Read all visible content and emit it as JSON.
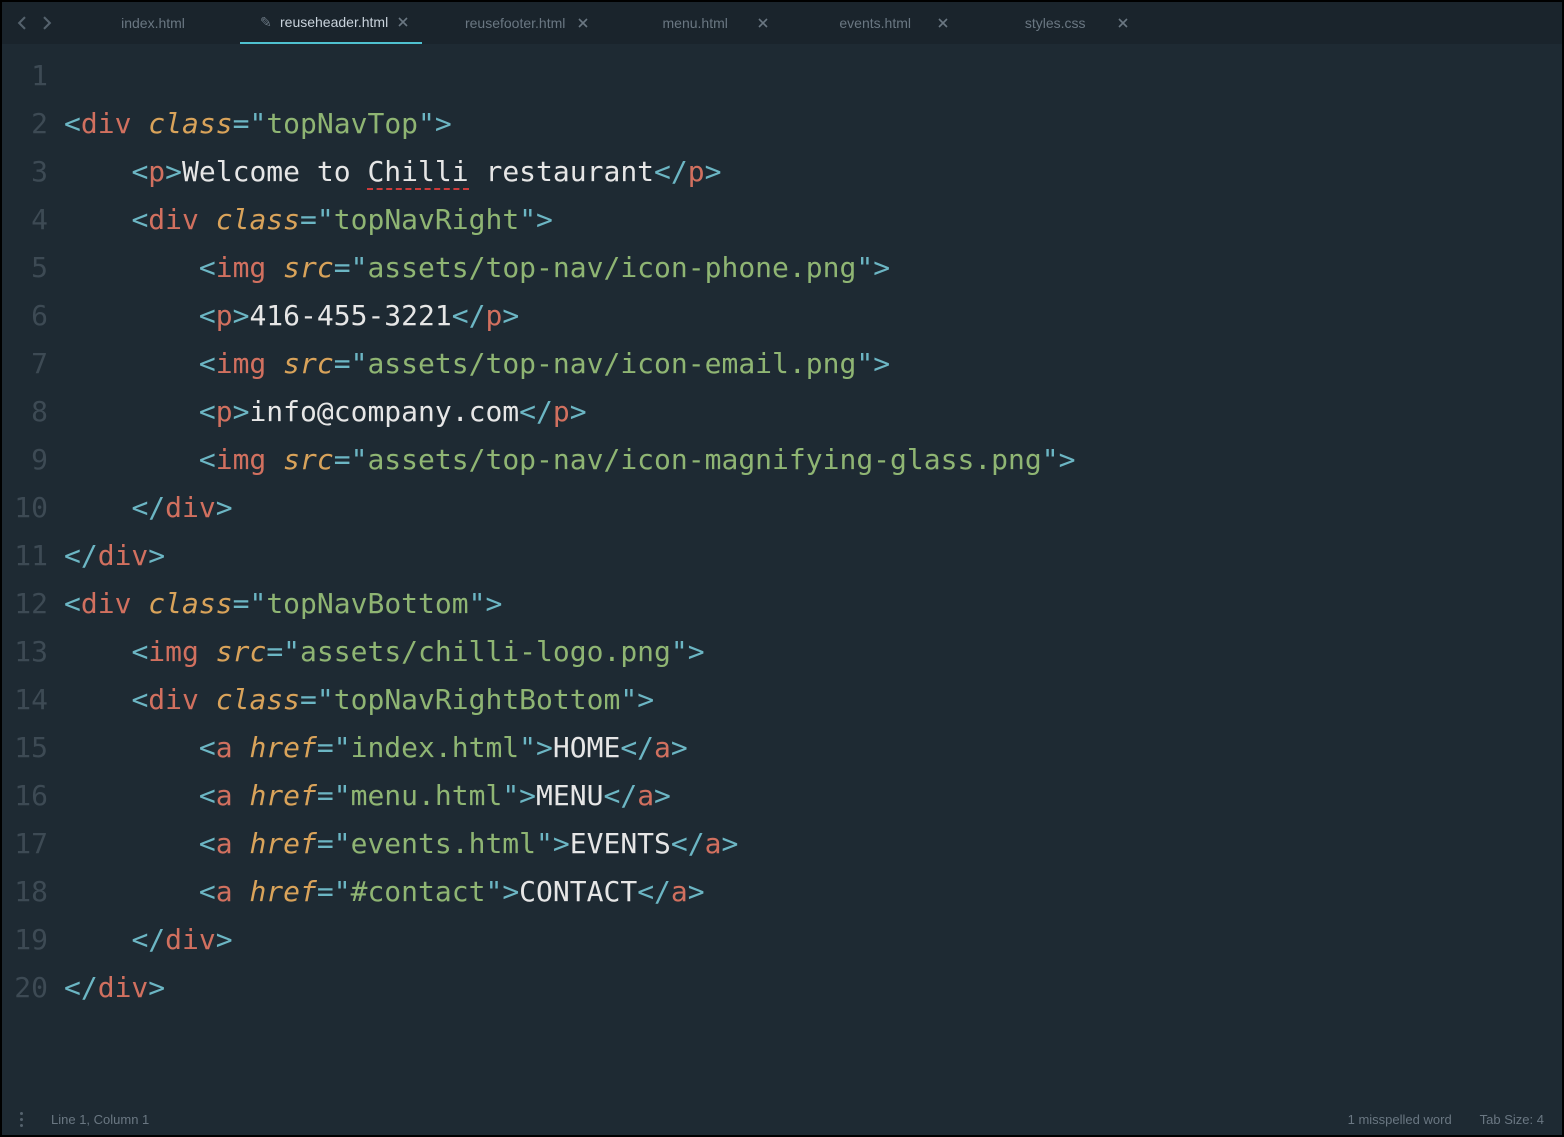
{
  "tabs": [
    {
      "label": "index.html",
      "active": false,
      "dirty": false,
      "closable": false
    },
    {
      "label": "reuseheader.html",
      "active": true,
      "dirty": true,
      "closable": true
    },
    {
      "label": "reusefooter.html",
      "active": false,
      "dirty": false,
      "closable": true
    },
    {
      "label": "menu.html",
      "active": false,
      "dirty": false,
      "closable": true
    },
    {
      "label": "events.html",
      "active": false,
      "dirty": false,
      "closable": true
    },
    {
      "label": "styles.css",
      "active": false,
      "dirty": false,
      "closable": true
    }
  ],
  "statusbar": {
    "position": "Line 1, Column 1",
    "spell": "1 misspelled word",
    "tabsize": "Tab Size: 4"
  },
  "code_lines": [
    [],
    [
      {
        "t": "punc",
        "v": "<"
      },
      {
        "t": "tag",
        "v": "div"
      },
      {
        "t": "text",
        "v": " "
      },
      {
        "t": "attr",
        "v": "class"
      },
      {
        "t": "punc",
        "v": "="
      },
      {
        "t": "punc",
        "v": "\""
      },
      {
        "t": "string",
        "v": "topNavTop"
      },
      {
        "t": "punc",
        "v": "\""
      },
      {
        "t": "punc",
        "v": ">"
      }
    ],
    [
      {
        "t": "text",
        "v": "    "
      },
      {
        "t": "punc",
        "v": "<"
      },
      {
        "t": "tag",
        "v": "p"
      },
      {
        "t": "punc",
        "v": ">"
      },
      {
        "t": "text",
        "v": "Welcome to "
      },
      {
        "t": "text",
        "v": "Chilli",
        "spell": true
      },
      {
        "t": "text",
        "v": " restaurant"
      },
      {
        "t": "punc",
        "v": "</"
      },
      {
        "t": "tag",
        "v": "p"
      },
      {
        "t": "punc",
        "v": ">"
      }
    ],
    [
      {
        "t": "text",
        "v": "    "
      },
      {
        "t": "punc",
        "v": "<"
      },
      {
        "t": "tag",
        "v": "div"
      },
      {
        "t": "text",
        "v": " "
      },
      {
        "t": "attr",
        "v": "class"
      },
      {
        "t": "punc",
        "v": "="
      },
      {
        "t": "punc",
        "v": "\""
      },
      {
        "t": "string",
        "v": "topNavRight"
      },
      {
        "t": "punc",
        "v": "\""
      },
      {
        "t": "punc",
        "v": ">"
      }
    ],
    [
      {
        "t": "text",
        "v": "        "
      },
      {
        "t": "punc",
        "v": "<"
      },
      {
        "t": "tag",
        "v": "img"
      },
      {
        "t": "text",
        "v": " "
      },
      {
        "t": "attr",
        "v": "src"
      },
      {
        "t": "punc",
        "v": "="
      },
      {
        "t": "punc",
        "v": "\""
      },
      {
        "t": "string",
        "v": "assets/top-nav/icon-phone.png"
      },
      {
        "t": "punc",
        "v": "\""
      },
      {
        "t": "punc",
        "v": ">"
      }
    ],
    [
      {
        "t": "text",
        "v": "        "
      },
      {
        "t": "punc",
        "v": "<"
      },
      {
        "t": "tag",
        "v": "p"
      },
      {
        "t": "punc",
        "v": ">"
      },
      {
        "t": "text",
        "v": "416-455-3221"
      },
      {
        "t": "punc",
        "v": "</"
      },
      {
        "t": "tag",
        "v": "p"
      },
      {
        "t": "punc",
        "v": ">"
      }
    ],
    [
      {
        "t": "text",
        "v": "        "
      },
      {
        "t": "punc",
        "v": "<"
      },
      {
        "t": "tag",
        "v": "img"
      },
      {
        "t": "text",
        "v": " "
      },
      {
        "t": "attr",
        "v": "src"
      },
      {
        "t": "punc",
        "v": "="
      },
      {
        "t": "punc",
        "v": "\""
      },
      {
        "t": "string",
        "v": "assets/top-nav/icon-email.png"
      },
      {
        "t": "punc",
        "v": "\""
      },
      {
        "t": "punc",
        "v": ">"
      }
    ],
    [
      {
        "t": "text",
        "v": "        "
      },
      {
        "t": "punc",
        "v": "<"
      },
      {
        "t": "tag",
        "v": "p"
      },
      {
        "t": "punc",
        "v": ">"
      },
      {
        "t": "text",
        "v": "info@company.com"
      },
      {
        "t": "punc",
        "v": "</"
      },
      {
        "t": "tag",
        "v": "p"
      },
      {
        "t": "punc",
        "v": ">"
      }
    ],
    [
      {
        "t": "text",
        "v": "        "
      },
      {
        "t": "punc",
        "v": "<"
      },
      {
        "t": "tag",
        "v": "img"
      },
      {
        "t": "text",
        "v": " "
      },
      {
        "t": "attr",
        "v": "src"
      },
      {
        "t": "punc",
        "v": "="
      },
      {
        "t": "punc",
        "v": "\""
      },
      {
        "t": "string",
        "v": "assets/top-nav/icon-magnifying-glass.png"
      },
      {
        "t": "punc",
        "v": "\""
      },
      {
        "t": "punc",
        "v": ">"
      }
    ],
    [
      {
        "t": "text",
        "v": "    "
      },
      {
        "t": "punc",
        "v": "</"
      },
      {
        "t": "tag",
        "v": "div"
      },
      {
        "t": "punc",
        "v": ">"
      }
    ],
    [
      {
        "t": "punc",
        "v": "</"
      },
      {
        "t": "tag",
        "v": "div"
      },
      {
        "t": "punc",
        "v": ">"
      }
    ],
    [
      {
        "t": "punc",
        "v": "<"
      },
      {
        "t": "tag",
        "v": "div"
      },
      {
        "t": "text",
        "v": " "
      },
      {
        "t": "attr",
        "v": "class"
      },
      {
        "t": "punc",
        "v": "="
      },
      {
        "t": "punc",
        "v": "\""
      },
      {
        "t": "string",
        "v": "topNavBottom"
      },
      {
        "t": "punc",
        "v": "\""
      },
      {
        "t": "punc",
        "v": ">"
      }
    ],
    [
      {
        "t": "text",
        "v": "    "
      },
      {
        "t": "punc",
        "v": "<"
      },
      {
        "t": "tag",
        "v": "img"
      },
      {
        "t": "text",
        "v": " "
      },
      {
        "t": "attr",
        "v": "src"
      },
      {
        "t": "punc",
        "v": "="
      },
      {
        "t": "punc",
        "v": "\""
      },
      {
        "t": "string",
        "v": "assets/chilli-logo.png"
      },
      {
        "t": "punc",
        "v": "\""
      },
      {
        "t": "punc",
        "v": ">"
      }
    ],
    [
      {
        "t": "text",
        "v": "    "
      },
      {
        "t": "punc",
        "v": "<"
      },
      {
        "t": "tag",
        "v": "div"
      },
      {
        "t": "text",
        "v": " "
      },
      {
        "t": "attr",
        "v": "class"
      },
      {
        "t": "punc",
        "v": "="
      },
      {
        "t": "punc",
        "v": "\""
      },
      {
        "t": "string",
        "v": "topNavRightBottom"
      },
      {
        "t": "punc",
        "v": "\""
      },
      {
        "t": "punc",
        "v": ">"
      }
    ],
    [
      {
        "t": "text",
        "v": "        "
      },
      {
        "t": "punc",
        "v": "<"
      },
      {
        "t": "tag",
        "v": "a"
      },
      {
        "t": "text",
        "v": " "
      },
      {
        "t": "attr",
        "v": "href"
      },
      {
        "t": "punc",
        "v": "="
      },
      {
        "t": "punc",
        "v": "\""
      },
      {
        "t": "string",
        "v": "index.html"
      },
      {
        "t": "punc",
        "v": "\""
      },
      {
        "t": "punc",
        "v": ">"
      },
      {
        "t": "text",
        "v": "HOME"
      },
      {
        "t": "punc",
        "v": "</"
      },
      {
        "t": "tag",
        "v": "a"
      },
      {
        "t": "punc",
        "v": ">"
      }
    ],
    [
      {
        "t": "text",
        "v": "        "
      },
      {
        "t": "punc",
        "v": "<"
      },
      {
        "t": "tag",
        "v": "a"
      },
      {
        "t": "text",
        "v": " "
      },
      {
        "t": "attr",
        "v": "href"
      },
      {
        "t": "punc",
        "v": "="
      },
      {
        "t": "punc",
        "v": "\""
      },
      {
        "t": "string",
        "v": "menu.html"
      },
      {
        "t": "punc",
        "v": "\""
      },
      {
        "t": "punc",
        "v": ">"
      },
      {
        "t": "text",
        "v": "MENU"
      },
      {
        "t": "punc",
        "v": "</"
      },
      {
        "t": "tag",
        "v": "a"
      },
      {
        "t": "punc",
        "v": ">"
      }
    ],
    [
      {
        "t": "text",
        "v": "        "
      },
      {
        "t": "punc",
        "v": "<"
      },
      {
        "t": "tag",
        "v": "a"
      },
      {
        "t": "text",
        "v": " "
      },
      {
        "t": "attr",
        "v": "href"
      },
      {
        "t": "punc",
        "v": "="
      },
      {
        "t": "punc",
        "v": "\""
      },
      {
        "t": "string",
        "v": "events.html"
      },
      {
        "t": "punc",
        "v": "\""
      },
      {
        "t": "punc",
        "v": ">"
      },
      {
        "t": "text",
        "v": "EVENTS"
      },
      {
        "t": "punc",
        "v": "</"
      },
      {
        "t": "tag",
        "v": "a"
      },
      {
        "t": "punc",
        "v": ">"
      }
    ],
    [
      {
        "t": "text",
        "v": "        "
      },
      {
        "t": "punc",
        "v": "<"
      },
      {
        "t": "tag",
        "v": "a"
      },
      {
        "t": "text",
        "v": " "
      },
      {
        "t": "attr",
        "v": "href"
      },
      {
        "t": "punc",
        "v": "="
      },
      {
        "t": "punc",
        "v": "\""
      },
      {
        "t": "string",
        "v": "#contact"
      },
      {
        "t": "punc",
        "v": "\""
      },
      {
        "t": "punc",
        "v": ">"
      },
      {
        "t": "text",
        "v": "CONTACT"
      },
      {
        "t": "punc",
        "v": "</"
      },
      {
        "t": "tag",
        "v": "a"
      },
      {
        "t": "punc",
        "v": ">"
      }
    ],
    [
      {
        "t": "text",
        "v": "    "
      },
      {
        "t": "punc",
        "v": "</"
      },
      {
        "t": "tag",
        "v": "div"
      },
      {
        "t": "punc",
        "v": ">"
      }
    ],
    [
      {
        "t": "punc",
        "v": "</"
      },
      {
        "t": "tag",
        "v": "div"
      },
      {
        "t": "punc",
        "v": ">"
      }
    ]
  ]
}
